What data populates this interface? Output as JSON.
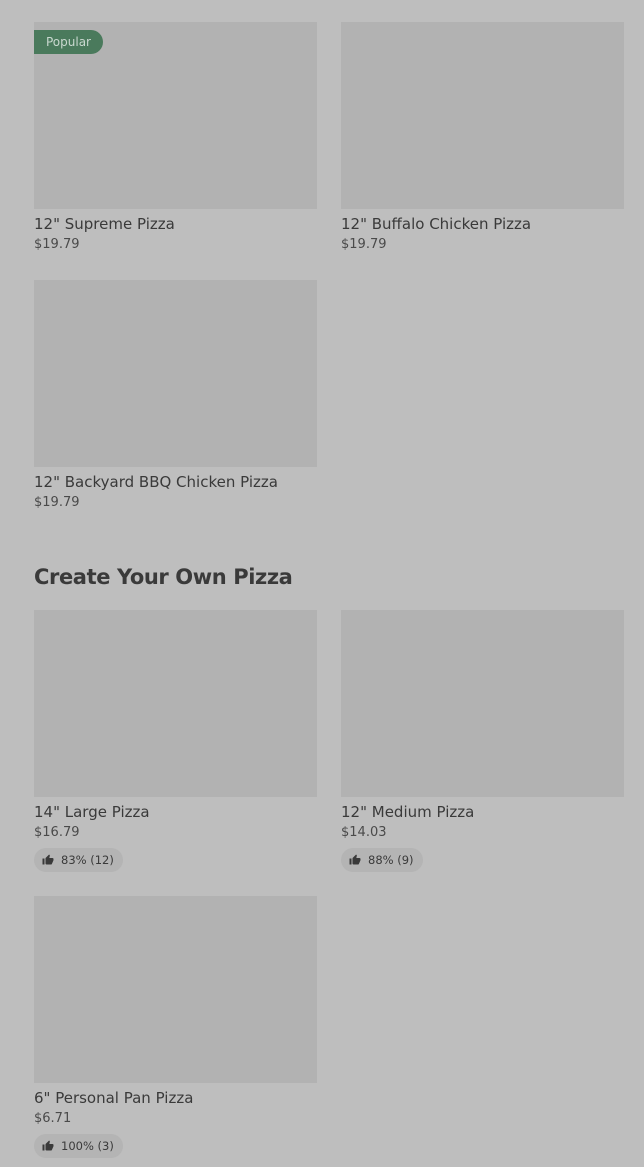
{
  "top_items": [
    {
      "name": "12\" Supreme Pizza",
      "price": "$19.79",
      "badge": "Popular"
    },
    {
      "name": "12\" Buffalo Chicken Pizza",
      "price": "$19.79"
    },
    {
      "name": "12\" Backyard BBQ Chicken Pizza",
      "price": "$19.79"
    }
  ],
  "create_section": {
    "title": "Create Your Own Pizza",
    "items": [
      {
        "name": "14\" Large Pizza",
        "price": "$16.79",
        "rating": "83% (12)"
      },
      {
        "name": "12\" Medium Pizza",
        "price": "$14.03",
        "rating": "88% (9)"
      },
      {
        "name": "6\" Personal Pan Pizza",
        "price": "$6.71",
        "rating": "100% (3)"
      }
    ]
  },
  "icons": {
    "rating": "thumbs-up-icon"
  },
  "colors": {
    "background": "#bebebe",
    "image_placeholder": "#b2b2b2",
    "badge": "#4a7a5c",
    "rating_pill": "#b4b4b4",
    "text": "#3a3a3a"
  }
}
